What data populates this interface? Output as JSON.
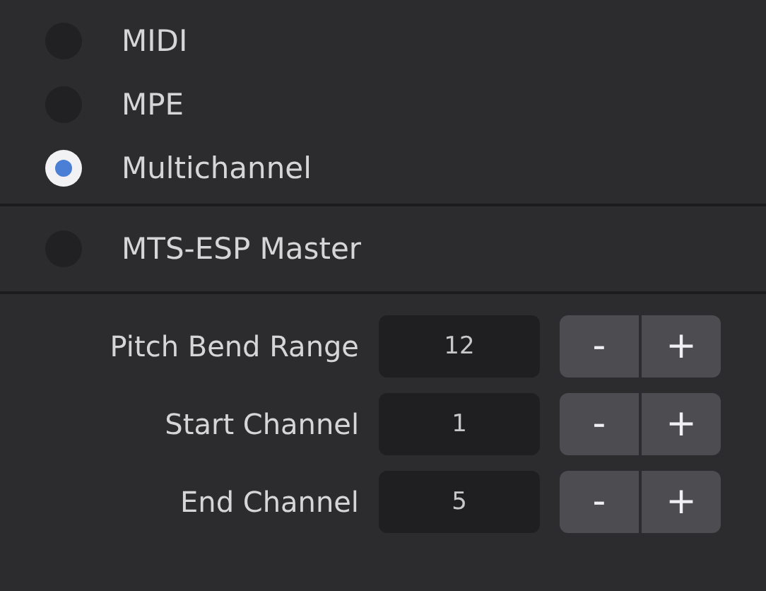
{
  "modes": [
    {
      "label": "MIDI",
      "selected": false
    },
    {
      "label": "MPE",
      "selected": false
    },
    {
      "label": "Multichannel",
      "selected": true
    }
  ],
  "master": {
    "label": "MTS-ESP Master",
    "checked": false
  },
  "settings": [
    {
      "label": "Pitch Bend Range",
      "value": "12",
      "minus": "-",
      "plus": "+"
    },
    {
      "label": "Start Channel",
      "value": "1",
      "minus": "-",
      "plus": "+"
    },
    {
      "label": "End Channel",
      "value": "5",
      "minus": "-",
      "plus": "+"
    }
  ]
}
